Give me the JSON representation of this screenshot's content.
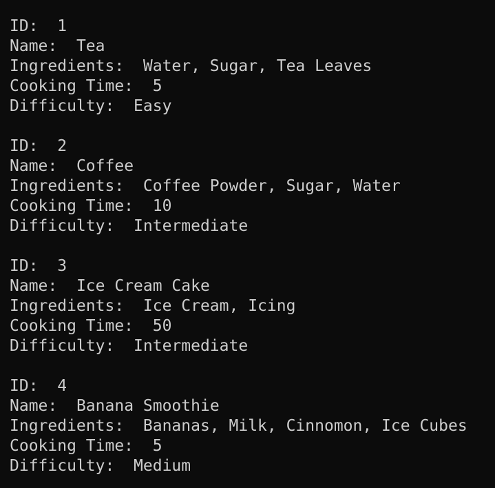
{
  "terminal": {
    "records": [
      {
        "id_label": "ID:",
        "id_value": "1",
        "name_label": "Name:",
        "name_value": "Tea",
        "ingredients_label": "Ingredients:",
        "ingredients_value": "Water, Sugar, Tea Leaves",
        "cooking_time_label": "Cooking Time:",
        "cooking_time_value": "5",
        "difficulty_label": "Difficulty:",
        "difficulty_value": "Easy"
      },
      {
        "id_label": "ID:",
        "id_value": "2",
        "name_label": "Name:",
        "name_value": "Coffee",
        "ingredients_label": "Ingredients:",
        "ingredients_value": "Coffee Powder, Sugar, Water",
        "cooking_time_label": "Cooking Time:",
        "cooking_time_value": "10",
        "difficulty_label": "Difficulty:",
        "difficulty_value": "Intermediate"
      },
      {
        "id_label": "ID:",
        "id_value": "3",
        "name_label": "Name:",
        "name_value": "Ice Cream Cake",
        "ingredients_label": "Ingredients:",
        "ingredients_value": "Ice Cream, Icing",
        "cooking_time_label": "Cooking Time:",
        "cooking_time_value": "50",
        "difficulty_label": "Difficulty:",
        "difficulty_value": "Intermediate"
      },
      {
        "id_label": "ID:",
        "id_value": "4",
        "name_label": "Name:",
        "name_value": "Banana Smoothie",
        "ingredients_label": "Ingredients:",
        "ingredients_value": "Bananas, Milk, Cinnomon, Ice Cubes",
        "cooking_time_label": "Cooking Time:",
        "cooking_time_value": "5",
        "difficulty_label": "Difficulty:",
        "difficulty_value": "Medium"
      }
    ]
  }
}
